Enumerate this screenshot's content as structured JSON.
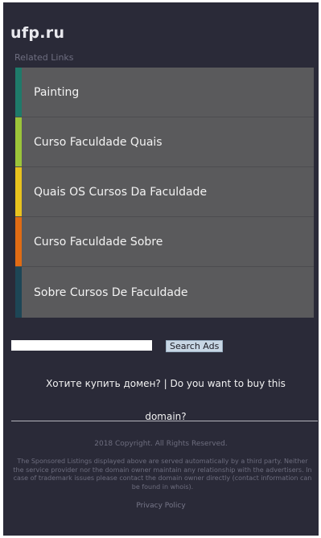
{
  "site": {
    "title": "ufp.ru"
  },
  "related": {
    "heading": "Related Links",
    "items": [
      {
        "label": "Painting",
        "color": "#1e7a6a"
      },
      {
        "label": "Curso Faculdade Quais",
        "color": "#9bc43a"
      },
      {
        "label": "Quais OS Cursos Da Faculdade",
        "color": "#e8c21e"
      },
      {
        "label": "Curso Faculdade Sobre",
        "color": "#e06b14"
      },
      {
        "label": "Sobre Cursos De Faculdade",
        "color": "#1d4656"
      }
    ]
  },
  "search": {
    "button_label": "Search Ads",
    "value": ""
  },
  "buy": {
    "line1": "Хотите купить домен? | Do you want to buy this",
    "line2": "domain?"
  },
  "footer": {
    "copyright": "2018 Copyright. All Rights Reserved.",
    "disclaimer": "The Sponsored Listings displayed above are served automatically by a third party. Neither the service provider nor the domain owner maintain any relationship with the advertisers. In case of trademark issues please contact the domain owner directly (contact information can be found in whois).",
    "privacy": "Privacy Policy"
  }
}
